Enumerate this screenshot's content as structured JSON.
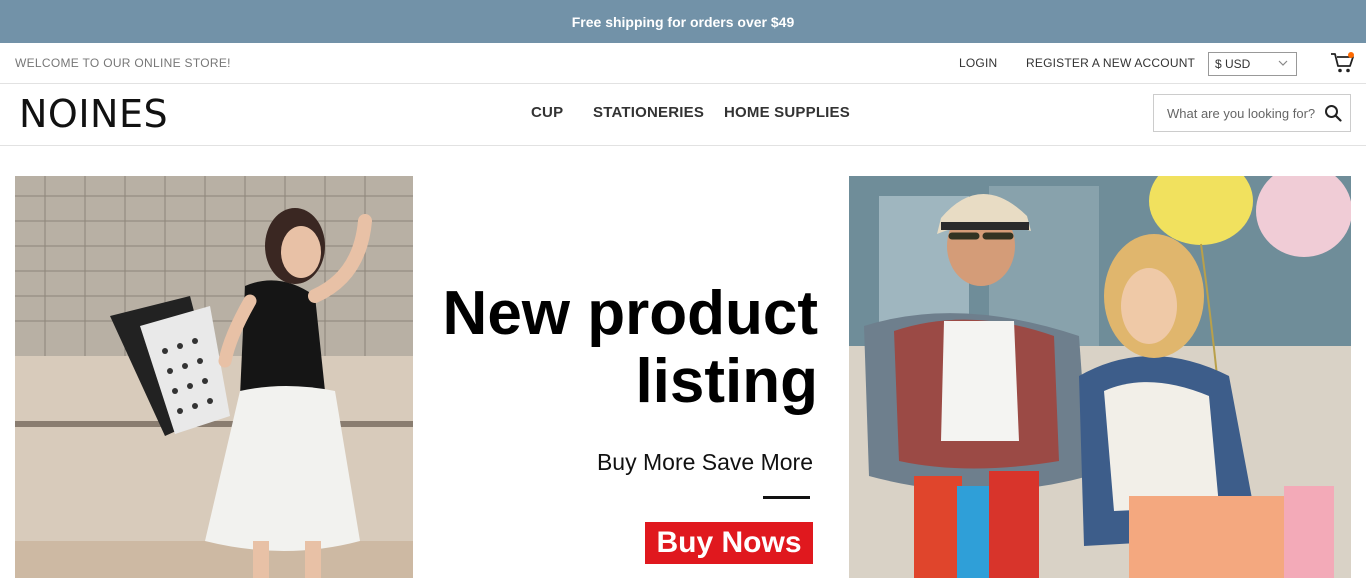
{
  "announcement": {
    "text": "Free shipping for orders over $49"
  },
  "topbar": {
    "welcome": "WELCOME TO OUR ONLINE STORE!",
    "login": "LOGIN",
    "register": "REGISTER A NEW ACCOUNT",
    "currency": "$ USD",
    "cart_icon": "cart-icon",
    "cart_badge_color": "#ff6a00"
  },
  "header": {
    "logo": "NOINES",
    "nav": [
      {
        "label": "CUP"
      },
      {
        "label": "STATIONERIES"
      },
      {
        "label": "HOME SUPPLIES"
      }
    ],
    "search": {
      "placeholder": "What are you looking for?",
      "icon": "search-icon"
    }
  },
  "hero": {
    "title_line1": "New product",
    "title_line2": "listing",
    "subtitle": "Buy More Save More",
    "button": "Buy Nows",
    "button_color": "#e0181e"
  },
  "colors": {
    "announcement_bg": "#7292a8",
    "accent_red": "#e0181e"
  }
}
